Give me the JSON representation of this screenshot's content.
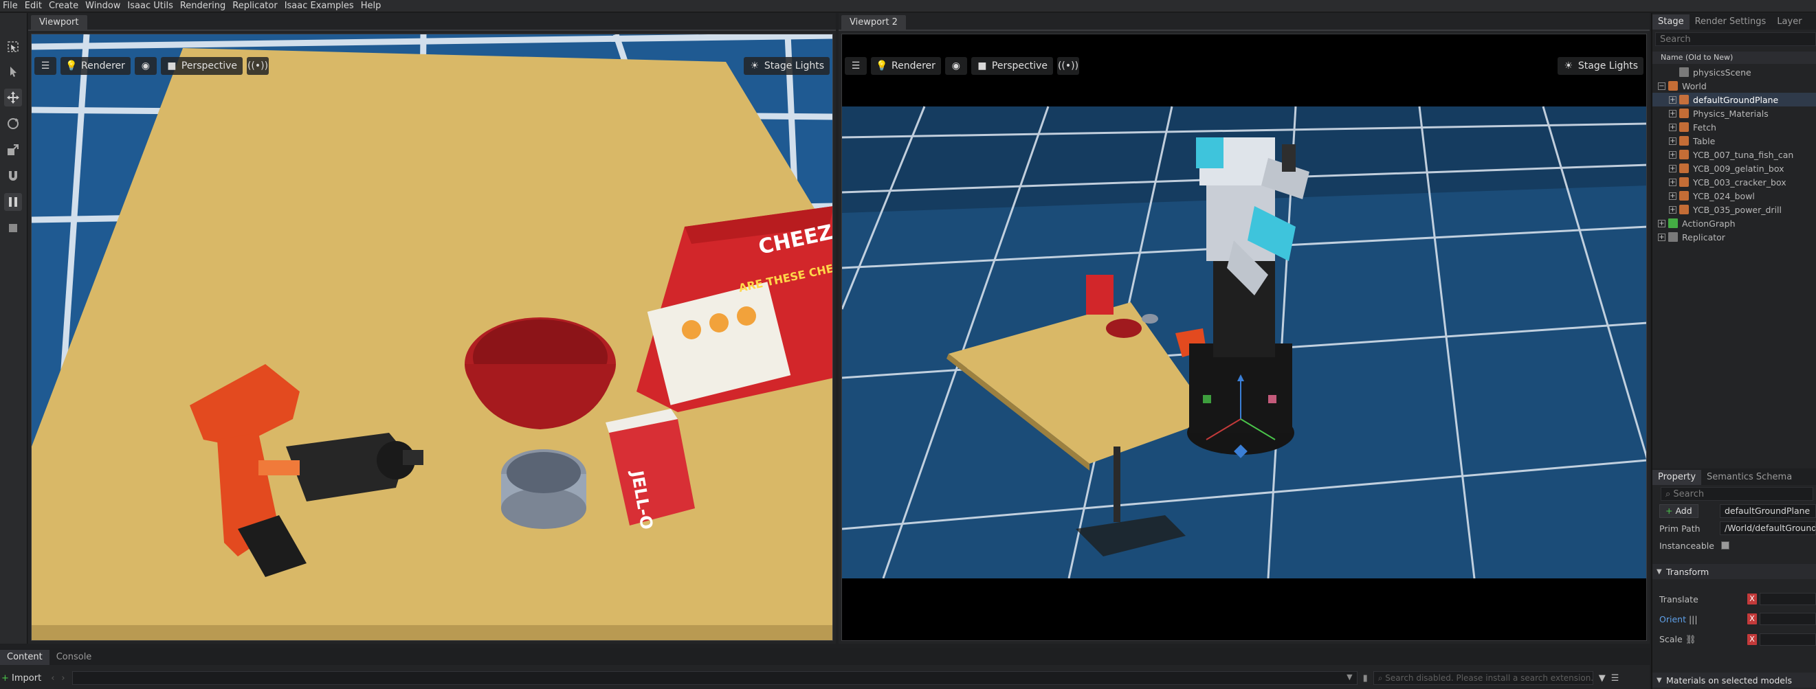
{
  "menu": [
    "File",
    "Edit",
    "Create",
    "Window",
    "Isaac Utils",
    "Rendering",
    "Replicator",
    "Isaac Examples",
    "Help"
  ],
  "viewport1": {
    "tab": "Viewport",
    "renderer_label": "Renderer",
    "camera_label": "Perspective",
    "lights_label": "Stage Lights",
    "cheezit_text": "CHEEZ-IT",
    "cheezit_tagline": "ARE THESE CHEESES READY?",
    "jello_text": "JELL-O"
  },
  "viewport2": {
    "tab": "Viewport 2",
    "renderer_label": "Renderer",
    "camera_label": "Perspective",
    "lights_label": "Stage Lights"
  },
  "stage": {
    "tabs": [
      "Stage",
      "Render Settings",
      "Layer"
    ],
    "search_placeholder": "Search",
    "tree_header": "Name (Old to New)",
    "items": [
      {
        "label": "physicsScene",
        "depth": 1,
        "expander": "",
        "icon": "physics-scene-icon",
        "selected": false
      },
      {
        "label": "World",
        "depth": 0,
        "expander": "−",
        "icon": "xform-icon",
        "selected": false
      },
      {
        "label": "defaultGroundPlane",
        "depth": 1,
        "expander": "+",
        "icon": "xform-icon",
        "selected": true
      },
      {
        "label": "Physics_Materials",
        "depth": 1,
        "expander": "+",
        "icon": "xform-icon",
        "selected": false
      },
      {
        "label": "Fetch",
        "depth": 1,
        "expander": "+",
        "icon": "xform-icon",
        "selected": false
      },
      {
        "label": "Table",
        "depth": 1,
        "expander": "+",
        "icon": "xform-icon",
        "selected": false
      },
      {
        "label": "YCB_007_tuna_fish_can",
        "depth": 1,
        "expander": "+",
        "icon": "xform-icon",
        "selected": false
      },
      {
        "label": "YCB_009_gelatin_box",
        "depth": 1,
        "expander": "+",
        "icon": "xform-icon",
        "selected": false
      },
      {
        "label": "YCB_003_cracker_box",
        "depth": 1,
        "expander": "+",
        "icon": "xform-icon",
        "selected": false
      },
      {
        "label": "YCB_024_bowl",
        "depth": 1,
        "expander": "+",
        "icon": "xform-icon",
        "selected": false
      },
      {
        "label": "YCB_035_power_drill",
        "depth": 1,
        "expander": "+",
        "icon": "xform-icon",
        "selected": false
      },
      {
        "label": "ActionGraph",
        "depth": 0,
        "expander": "+",
        "icon": "graph-icon",
        "selected": false
      },
      {
        "label": "Replicator",
        "depth": 0,
        "expander": "+",
        "icon": "folder-icon",
        "selected": false
      }
    ]
  },
  "property": {
    "tabs": [
      "Property",
      "Semantics Schema Editor"
    ],
    "search_placeholder": "Search",
    "add_label": "Add",
    "name_value": "defaultGroundPlane",
    "prim_path_label": "Prim Path",
    "prim_path_value": "/World/defaultGroundPlane",
    "instanceable_label": "Instanceable",
    "transform_label": "Transform",
    "translate_label": "Translate",
    "orient_label": "Orient",
    "scale_label": "Scale",
    "axis_x": "X",
    "materials_label": "Materials on selected models"
  },
  "bottom": {
    "tabs": [
      "Content",
      "Console"
    ],
    "import_label": "Import",
    "search_placeholder": "Search disabled. Please install a search extension."
  },
  "colors": {
    "accent_blue": "#3b7fd6",
    "selected_row": "#2f3a4a",
    "x_axis_red": "#c33a3a",
    "table_top": "#d9b867"
  }
}
